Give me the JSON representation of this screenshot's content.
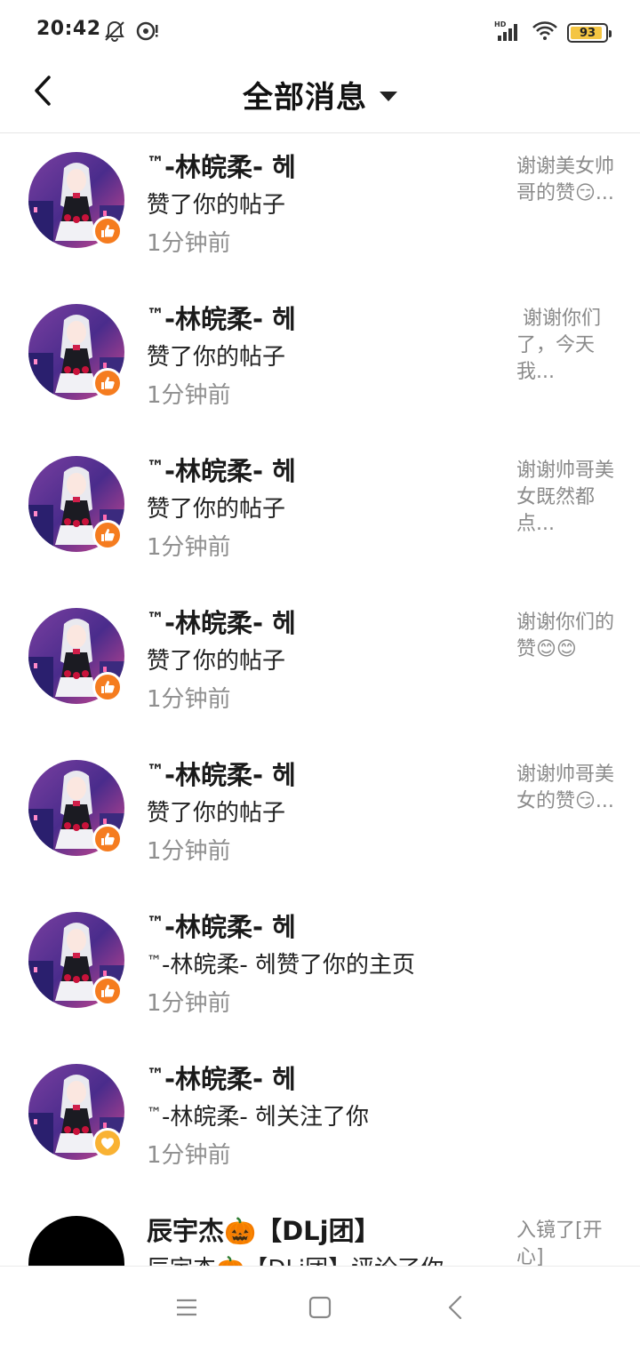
{
  "status_bar": {
    "time": "20:42",
    "icons_left": [
      "bell-off-icon",
      "disc-alert-icon"
    ],
    "icons_right": [
      "hd-signal-icon",
      "wifi-icon",
      "battery-icon"
    ],
    "battery_level": "93",
    "battery_fraction": 0.93
  },
  "header": {
    "back_icon": "back-arrow-icon",
    "title": "全部消息",
    "dropdown_icon": "caret-down-icon"
  },
  "messages": [
    {
      "name": "-林皖柔- 헤",
      "name_prefix": "™",
      "action": "赞了你的帖子",
      "time": "1分钟前",
      "preview": "谢谢美女帅哥的赞😏...",
      "badge": "like"
    },
    {
      "name": "-林皖柔- 헤",
      "name_prefix": "™",
      "action": "赞了你的帖子",
      "time": "1分钟前",
      "preview": " 谢谢你们了，今天我...",
      "badge": "like"
    },
    {
      "name": "-林皖柔- 헤",
      "name_prefix": "™",
      "action": "赞了你的帖子",
      "time": "1分钟前",
      "preview": "谢谢帅哥美女既然都点...",
      "badge": "like"
    },
    {
      "name": "-林皖柔- 헤",
      "name_prefix": "™",
      "action": "赞了你的帖子",
      "time": "1分钟前",
      "preview": "谢谢你们的赞😊😊",
      "badge": "like"
    },
    {
      "name": "-林皖柔- 헤",
      "name_prefix": "™",
      "action": "赞了你的帖子",
      "time": "1分钟前",
      "preview": "谢谢帅哥美女的赞😏...",
      "badge": "like"
    },
    {
      "name": "-林皖柔- 헤",
      "name_prefix": "™",
      "action": "-林皖柔- 헤赞了你的主页",
      "action_prefix": "™",
      "time": "1分钟前",
      "preview": "",
      "badge": "like"
    },
    {
      "name": "-林皖柔- 헤",
      "name_prefix": "™",
      "action": "-林皖柔- 헤关注了你",
      "action_prefix": "™",
      "time": "1分钟前",
      "preview": "",
      "badge": "follow"
    },
    {
      "name": "辰宇杰🎃【DLj团】",
      "name_prefix": "",
      "action": "辰宇杰🎃【DLj团】评论了你",
      "time": "",
      "preview": "入镜了[开心]",
      "badge": "none"
    }
  ],
  "nav_bar": {
    "menu_icon": "menu-icon",
    "home_icon": "home-square-icon",
    "back_icon": "back-triangle-icon"
  },
  "colors": {
    "like_badge": "#f57c1f",
    "follow_badge": "#f9b233",
    "muted_text": "#8f8f8f"
  }
}
